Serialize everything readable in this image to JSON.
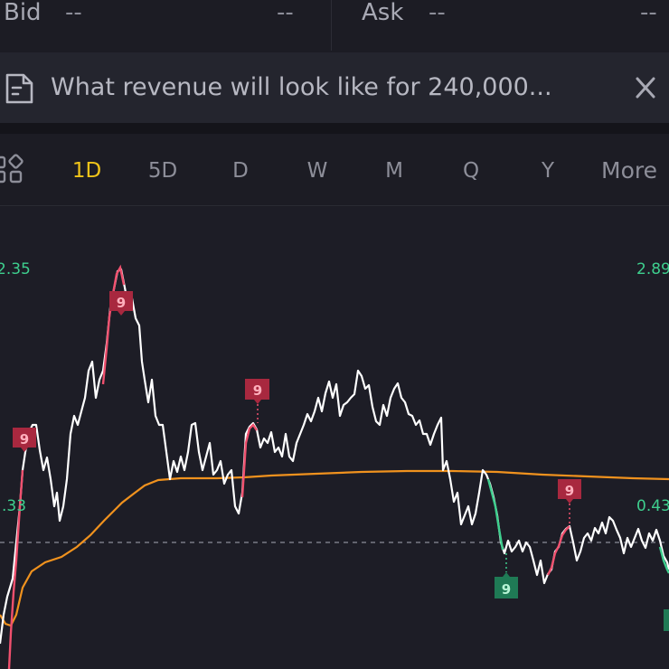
{
  "quote": {
    "bid_label": "Bid",
    "bid_value": "--",
    "bid_size": "--",
    "ask_label": "Ask",
    "ask_value": "--",
    "ask_size": "--"
  },
  "news": {
    "icon": "document-icon",
    "text": "What revenue will look like for 240,000...",
    "close_icon": "close-icon"
  },
  "periods": {
    "layout_icon": "grid-layout-icon",
    "items": [
      "1D",
      "5D",
      "D",
      "W",
      "M",
      "Q",
      "Y",
      "More"
    ],
    "active": "1D"
  },
  "colors": {
    "price_line": "#ffffff",
    "avg_line": "#f0921e",
    "up_segment": "#f0506e",
    "down_segment": "#3ecf8e",
    "active_period": "#f0c419"
  },
  "chart_data": {
    "type": "line",
    "left_axis_labels": [
      "2.35",
      ".33"
    ],
    "right_axis_labels": [
      "2.89",
      "0.43"
    ],
    "markers": [
      {
        "label": "9",
        "kind": "sell"
      },
      {
        "label": "9",
        "kind": "sell"
      },
      {
        "label": "9",
        "kind": "sell"
      },
      {
        "label": "9",
        "kind": "sell"
      },
      {
        "label": "9",
        "kind": "buy"
      }
    ]
  }
}
